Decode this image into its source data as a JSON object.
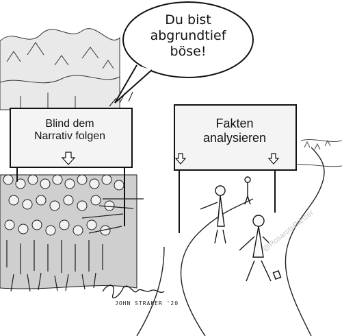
{
  "bubble": {
    "text_line1": "Du bist",
    "text_line2": "abgrundtief",
    "text_line3": "böse!"
  },
  "sign_left": {
    "line1": "Blind dem",
    "line2": "Narrativ folgen"
  },
  "sign_right": {
    "line1": "Fakten",
    "line2": "analysieren"
  },
  "watermark": {
    "text": "@RosarotePanzer"
  },
  "signature": {
    "name": "JOHN STRAKER '20"
  },
  "colors": {
    "ink": "#1a1a1a",
    "paper": "#ffffff",
    "sign_fill": "#f4f4f4"
  }
}
